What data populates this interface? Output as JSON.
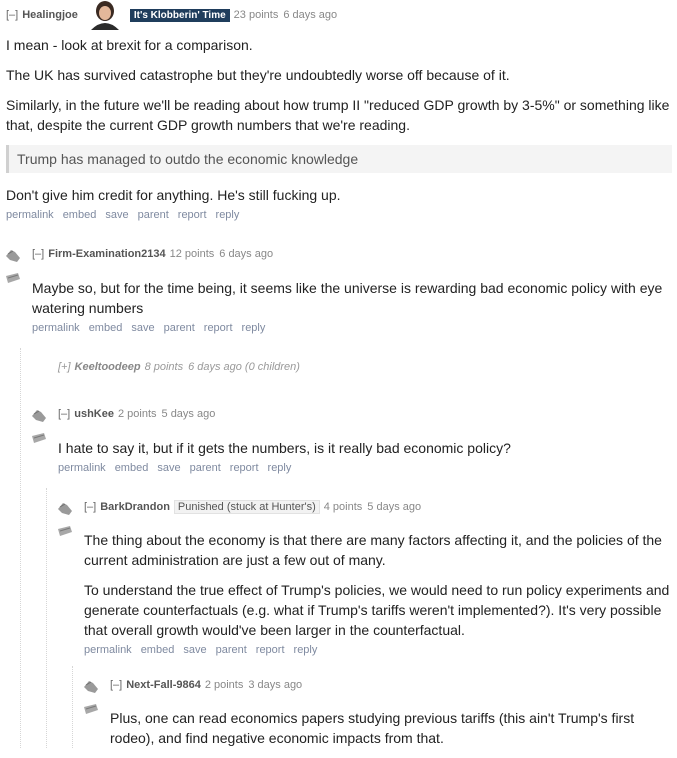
{
  "c1": {
    "expand": "[–]",
    "author": "Healingjoe",
    "flair": "It's Klobberin' Time",
    "points": "23 points",
    "time": "6 days ago",
    "paragraphs": [
      "I mean - look at brexit for a comparison.",
      "The UK has survived catastrophe but they're undoubtedly worse off because of it.",
      "Similarly, in the future we'll be reading about how trump II \"reduced GDP growth by 3-5%\" or something like that, despite the current GDP growth numbers that we're reading."
    ],
    "quote": "Trump has managed to outdo the economic knowledge",
    "after_quote": "Don't give him credit for anything. He's still fucking up."
  },
  "buttons": [
    "permalink",
    "embed",
    "save",
    "parent",
    "report",
    "reply"
  ],
  "c2": {
    "expand": "[–]",
    "author": "Firm-Examination2134",
    "points": "12 points",
    "time": "6 days ago",
    "text": "Maybe so, but for the time being, it seems like the universe is rewarding bad economic policy with eye watering numbers"
  },
  "c3": {
    "expand": "[+]",
    "author": "Keeltoodeep",
    "points": "8 points",
    "time": "6 days ago",
    "children": "(0 children)"
  },
  "c4": {
    "expand": "[–]",
    "author": "ushKee",
    "points": "2 points",
    "time": "5 days ago",
    "text": "I hate to say it, but if it gets the numbers, is it really bad economic policy?"
  },
  "c5": {
    "expand": "[–]",
    "author": "BarkDrandon",
    "flair": "Punished (stuck at Hunter's)",
    "points": "4 points",
    "time": "5 days ago",
    "paragraphs": [
      "The thing about the economy is that there are many factors affecting it, and the policies of the current administration are just a few out of many.",
      "To understand the true effect of Trump's policies, we would need to run policy experiments and generate counterfactuals (e.g. what if Trump's tariffs weren't implemented?). It's very possible that overall growth would've been larger in the counterfactual."
    ]
  },
  "c6": {
    "expand": "[–]",
    "author": "Next-Fall-9864",
    "points": "2 points",
    "time": "3 days ago",
    "text": "Plus, one can read economics papers studying previous tariffs (this ain't Trump's first rodeo), and find negative economic impacts from that."
  }
}
